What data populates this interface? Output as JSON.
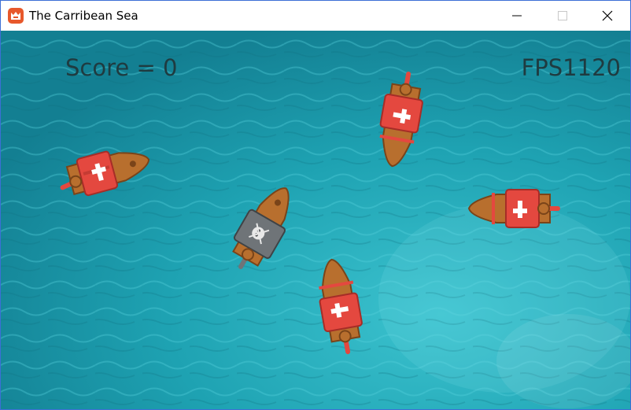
{
  "window": {
    "title": "The Carribean Sea",
    "controls": [
      "minimize",
      "maximize",
      "close"
    ]
  },
  "hud": {
    "score_text": "Score = 0",
    "fps_text": "FPS1120"
  },
  "sea": {
    "color": "#1f9fae"
  },
  "ships": [
    {
      "name": "enemy-ship",
      "team": "enemy",
      "sail_color": "#e4483f"
    },
    {
      "name": "enemy-ship",
      "team": "enemy",
      "sail_color": "#e4483f"
    },
    {
      "name": "enemy-ship",
      "team": "enemy",
      "sail_color": "#e4483f"
    },
    {
      "name": "enemy-ship",
      "team": "enemy",
      "sail_color": "#e4483f"
    },
    {
      "name": "player-ship",
      "team": "player",
      "sail_color": "#6f7478"
    }
  ],
  "colors": {
    "hull": "#b86f2e",
    "hull_dark": "#7a4419",
    "enemy_sail": "#e4483f",
    "player_sail": "#6f7478",
    "cross": "#ffffff"
  }
}
